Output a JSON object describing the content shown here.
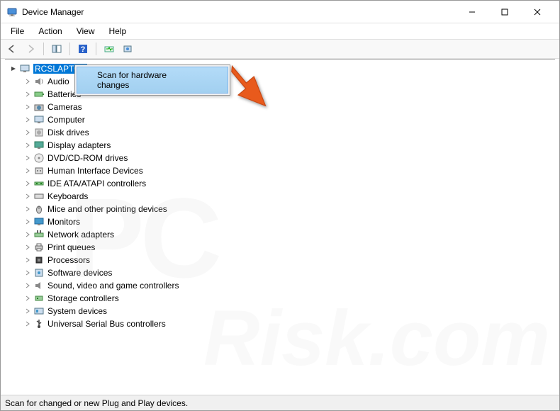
{
  "window": {
    "title": "Device Manager"
  },
  "menubar": {
    "items": [
      "File",
      "Action",
      "View",
      "Help"
    ]
  },
  "toolbar": {
    "buttons": [
      {
        "name": "back-icon"
      },
      {
        "name": "forward-icon"
      },
      {
        "name": "show-hide-tree-icon"
      },
      {
        "name": "help-icon"
      },
      {
        "name": "scan-hardware-icon"
      },
      {
        "name": "add-legacy-icon"
      }
    ]
  },
  "tree": {
    "root": {
      "label": "RCSLAPTOP",
      "selected": true,
      "expanded": true
    },
    "children": [
      {
        "label": "Audio",
        "icon": "audio-icon"
      },
      {
        "label": "Batteries",
        "icon": "battery-icon"
      },
      {
        "label": "Cameras",
        "icon": "camera-icon"
      },
      {
        "label": "Computer",
        "icon": "computer-icon"
      },
      {
        "label": "Disk drives",
        "icon": "disk-icon"
      },
      {
        "label": "Display adapters",
        "icon": "display-icon"
      },
      {
        "label": "DVD/CD-ROM drives",
        "icon": "dvd-icon"
      },
      {
        "label": "Human Interface Devices",
        "icon": "hid-icon"
      },
      {
        "label": "IDE ATA/ATAPI controllers",
        "icon": "ide-icon"
      },
      {
        "label": "Keyboards",
        "icon": "keyboard-icon"
      },
      {
        "label": "Mice and other pointing devices",
        "icon": "mouse-icon"
      },
      {
        "label": "Monitors",
        "icon": "monitor-icon"
      },
      {
        "label": "Network adapters",
        "icon": "network-icon"
      },
      {
        "label": "Print queues",
        "icon": "print-icon"
      },
      {
        "label": "Processors",
        "icon": "processor-icon"
      },
      {
        "label": "Software devices",
        "icon": "software-icon"
      },
      {
        "label": "Sound, video and game controllers",
        "icon": "sound-icon"
      },
      {
        "label": "Storage controllers",
        "icon": "storage-icon"
      },
      {
        "label": "System devices",
        "icon": "system-icon"
      },
      {
        "label": "Universal Serial Bus controllers",
        "icon": "usb-icon"
      }
    ]
  },
  "context_menu": {
    "item": "Scan for hardware changes"
  },
  "statusbar": {
    "text": "Scan for changed or new Plug and Play devices."
  },
  "watermark": {
    "a": "PC",
    "b": "Risk.com"
  }
}
